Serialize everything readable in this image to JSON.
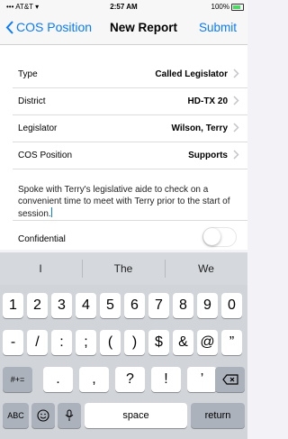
{
  "status_bar": {
    "carrier": "AT&T",
    "time": "2:57 AM",
    "battery": "100%"
  },
  "nav": {
    "back_label": "COS Position",
    "title": "New Report",
    "submit_label": "Submit"
  },
  "form": {
    "rows": [
      {
        "label": "Type",
        "value": "Called Legislator"
      },
      {
        "label": "District",
        "value": "HD-TX 20"
      },
      {
        "label": "Legislator",
        "value": "Wilson, Terry"
      },
      {
        "label": "COS Position",
        "value": "Supports"
      }
    ],
    "notes": "Spoke with Terry's legislative aide to check on a convenient time to meet with Terry prior to the start of session.",
    "confidential_label": "Confidential",
    "confidential_on": false
  },
  "keyboard": {
    "suggestions": [
      "I",
      "The",
      "We"
    ],
    "row1": [
      "1",
      "2",
      "3",
      "4",
      "5",
      "6",
      "7",
      "8",
      "9",
      "0"
    ],
    "row2": [
      "-",
      "/",
      ":",
      ";",
      "(",
      ")",
      "$",
      "&",
      "@",
      "”"
    ],
    "row3_left": "#+=",
    "row3": [
      ".",
      ",",
      "?",
      "!",
      "’"
    ],
    "abc_label": "ABC",
    "space_label": "space",
    "return_label": "return"
  },
  "colors": {
    "accent": "#0a7aff",
    "keyboard_bg": "#d1d4d9"
  }
}
